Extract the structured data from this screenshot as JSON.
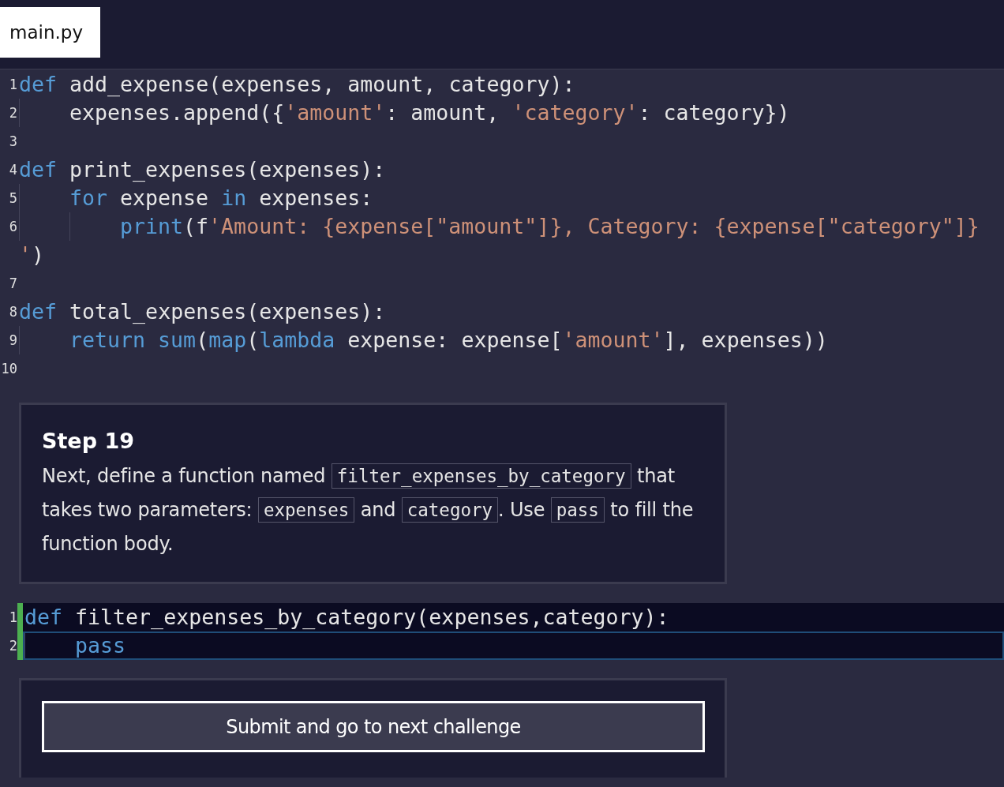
{
  "tabs": [
    {
      "label": "main.py",
      "selected": true
    }
  ],
  "code": {
    "lines": [
      {
        "number": "1",
        "tokens": [
          {
            "kind": "keyword",
            "text": "def"
          },
          {
            "kind": "plain",
            "text": " add_expense(expenses, amount, category):"
          }
        ]
      },
      {
        "number": "2",
        "tokens": [
          {
            "kind": "plain",
            "text": "    expenses.append({"
          },
          {
            "kind": "string",
            "text": "'amount'"
          },
          {
            "kind": "plain",
            "text": ": amount, "
          },
          {
            "kind": "string",
            "text": "'category'"
          },
          {
            "kind": "plain",
            "text": ": category})"
          }
        ]
      },
      {
        "number": "3"
      },
      {
        "number": "4",
        "tokens": [
          {
            "kind": "keyword",
            "text": "def"
          },
          {
            "kind": "plain",
            "text": " print_expenses(expenses):"
          }
        ]
      },
      {
        "number": "5",
        "tokens": [
          {
            "kind": "keyword",
            "text": "    for"
          },
          {
            "kind": "plain",
            "text": " expense "
          },
          {
            "kind": "keyword",
            "text": "in"
          },
          {
            "kind": "plain",
            "text": " expenses:"
          }
        ]
      },
      {
        "number": "6",
        "tokens": [
          {
            "kind": "keyword",
            "text": "        print"
          },
          {
            "kind": "plain",
            "text": "(f"
          },
          {
            "kind": "string",
            "text": "'Amount: {expense[\"amount\"]}, Category: {expense[\"category\"]}"
          },
          {
            "kind": "string",
            "text": "'"
          },
          {
            "kind": "plain",
            "text": ")"
          }
        ]
      },
      {
        "number": "7"
      },
      {
        "number": "8",
        "tokens": [
          {
            "kind": "keyword",
            "text": "def"
          },
          {
            "kind": "plain",
            "text": " total_expenses(expenses):"
          }
        ]
      },
      {
        "number": "9",
        "tokens": [
          {
            "kind": "keyword",
            "text": "    return"
          },
          {
            "kind": "keyword",
            "text": " sum"
          },
          {
            "kind": "plain",
            "text": "("
          },
          {
            "kind": "keyword",
            "text": "map"
          },
          {
            "kind": "plain",
            "text": "("
          },
          {
            "kind": "keyword",
            "text": "lambda"
          },
          {
            "kind": "plain",
            "text": " expense: expense["
          },
          {
            "kind": "string",
            "text": "'amount'"
          },
          {
            "kind": "plain",
            "text": "], expenses))"
          }
        ]
      },
      {
        "number": "10"
      }
    ]
  },
  "instructions": {
    "title": "Step 19",
    "segments": [
      {
        "kind": "text",
        "text": "Next, define a function named "
      },
      {
        "kind": "code",
        "text": "filter_expenses_by_category"
      },
      {
        "kind": "text",
        "text": " that takes two parameters: "
      },
      {
        "kind": "code",
        "text": "expenses"
      },
      {
        "kind": "text",
        "text": " and "
      },
      {
        "kind": "code",
        "text": "category"
      },
      {
        "kind": "text",
        "text": ". Use "
      },
      {
        "kind": "code",
        "text": "pass"
      },
      {
        "kind": "text",
        "text": " to fill the function body."
      }
    ]
  },
  "answer_editor": {
    "lines": [
      {
        "number": "1",
        "active": false,
        "tokens": [
          {
            "kind": "keyword",
            "text": "def"
          },
          {
            "kind": "plain",
            "text": " filter_expenses_by_category(expenses,category):"
          }
        ]
      },
      {
        "number": "2",
        "active": true,
        "tokens": [
          {
            "kind": "keyword",
            "text": "    pass"
          }
        ]
      }
    ]
  },
  "submit_button": {
    "label": "Submit and go to next challenge"
  }
}
